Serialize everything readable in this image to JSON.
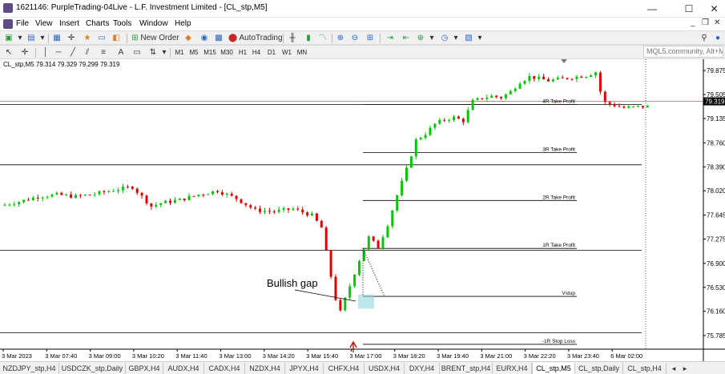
{
  "window": {
    "title": "1621146: PurpleTrading-04Live - L.F. Investment Limited - [CL_stp,M5]",
    "minimize": "—",
    "maximize": "☐",
    "close": "✕"
  },
  "menu": {
    "items": [
      "File",
      "View",
      "Insert",
      "Charts",
      "Tools",
      "Window",
      "Help"
    ],
    "mdi_minimize": "_",
    "mdi_restore": "❐",
    "mdi_close": "✕"
  },
  "toolbar": {
    "new_order": "New Order",
    "auto_trading": "AutoTrading",
    "timeframes": [
      "M1",
      "M5",
      "M15",
      "M30",
      "H1",
      "H4",
      "D1",
      "W1",
      "MN"
    ],
    "search_placeholder": "MQL5.community, Alt+M"
  },
  "chart": {
    "info": "CL_stp,M5  79.314 79.329 79.299 79.319",
    "current_price": "79.319",
    "price_labels": [
      "79.875",
      "79.505",
      "79.135",
      "78.760",
      "78.390",
      "78.020",
      "77.645",
      "77.275",
      "76.900",
      "76.530",
      "76.160",
      "75.785"
    ],
    "time_labels": [
      "3 Mar 2023",
      "3 Mar 07:40",
      "3 Mar 09:00",
      "3 Mar 10:20",
      "3 Mar 11:40",
      "3 Mar 13:00",
      "3 Mar 14:20",
      "3 Mar 15:40",
      "3 Mar 17:00",
      "3 Mar 18:20",
      "3 Mar 19:40",
      "3 Mar 21:00",
      "3 Mar 22:20",
      "3 Mar 23:40",
      "6 Mar 02:00"
    ],
    "levels": [
      "4R Take Profit",
      "3R Take Profit",
      "2R Take Profit",
      "1R Take Profit",
      "Vstup",
      "-1R Stop Loss"
    ],
    "annotation": "Bullish gap",
    "colors": {
      "bull": "#00c800",
      "bear": "#e00000",
      "line": "#000000",
      "price_line": "#e08080"
    }
  },
  "chart_data": {
    "type": "candlestick",
    "symbol": "CL_stp",
    "timeframe": "M5",
    "ohlc_last": {
      "open": 79.314,
      "high": 79.329,
      "low": 79.299,
      "close": 79.319
    },
    "y_range": [
      75.6,
      80.0
    ],
    "y_ticks": [
      79.875,
      79.505,
      79.135,
      78.76,
      78.39,
      78.02,
      77.645,
      77.275,
      76.9,
      76.53,
      76.16,
      75.785
    ],
    "price_path": [
      [
        0,
        77.79
      ],
      [
        4,
        77.85
      ],
      [
        8,
        77.93
      ],
      [
        12,
        77.96
      ],
      [
        16,
        77.93
      ],
      [
        20,
        77.97
      ],
      [
        24,
        78.03
      ],
      [
        28,
        78.08
      ],
      [
        32,
        77.78
      ],
      [
        34,
        77.83
      ],
      [
        38,
        77.88
      ],
      [
        42,
        77.96
      ],
      [
        46,
        78.02
      ],
      [
        50,
        77.9
      ],
      [
        54,
        77.72
      ],
      [
        58,
        77.7
      ],
      [
        62,
        77.74
      ],
      [
        66,
        77.64
      ],
      [
        68,
        77.45
      ],
      [
        70,
        76.7
      ],
      [
        71,
        76.35
      ],
      [
        72,
        76.15
      ],
      [
        74,
        76.55
      ],
      [
        76,
        76.95
      ],
      [
        78,
        77.3
      ],
      [
        80,
        77.15
      ],
      [
        82,
        77.5
      ],
      [
        84,
        77.95
      ],
      [
        86,
        78.35
      ],
      [
        88,
        78.8
      ],
      [
        90,
        78.9
      ],
      [
        92,
        79.05
      ],
      [
        94,
        79.12
      ],
      [
        96,
        79.15
      ],
      [
        98,
        79.1
      ],
      [
        100,
        79.4
      ],
      [
        102,
        79.45
      ],
      [
        104,
        79.48
      ],
      [
        106,
        79.46
      ],
      [
        108,
        79.55
      ],
      [
        110,
        79.7
      ],
      [
        112,
        79.78
      ],
      [
        116,
        79.72
      ],
      [
        120,
        79.76
      ],
      [
        124,
        79.8
      ],
      [
        126,
        79.85
      ],
      [
        127,
        79.55
      ],
      [
        128,
        79.38
      ],
      [
        130,
        79.34
      ],
      [
        132,
        79.3
      ],
      [
        136,
        79.32
      ]
    ],
    "horizontal_levels": [
      {
        "name": "4R Take Profit",
        "y": 79.35
      },
      {
        "name": "3R Take Profit",
        "y": 78.61
      },
      {
        "name": "2R Take Profit",
        "y": 77.87
      },
      {
        "name": "1R Take Profit",
        "y": 77.13
      },
      {
        "name": "Vstup",
        "y": 76.39
      },
      {
        "name": "-1R Stop Loss",
        "y": 75.65
      }
    ],
    "left_lines": [
      {
        "y": 79.35
      },
      {
        "y": 78.42
      },
      {
        "y": 77.1
      },
      {
        "y": 75.83
      }
    ],
    "bid_line": 79.4,
    "gap": {
      "from": 76.2,
      "to": 76.42
    },
    "annotation": "Bullish gap"
  }
}
